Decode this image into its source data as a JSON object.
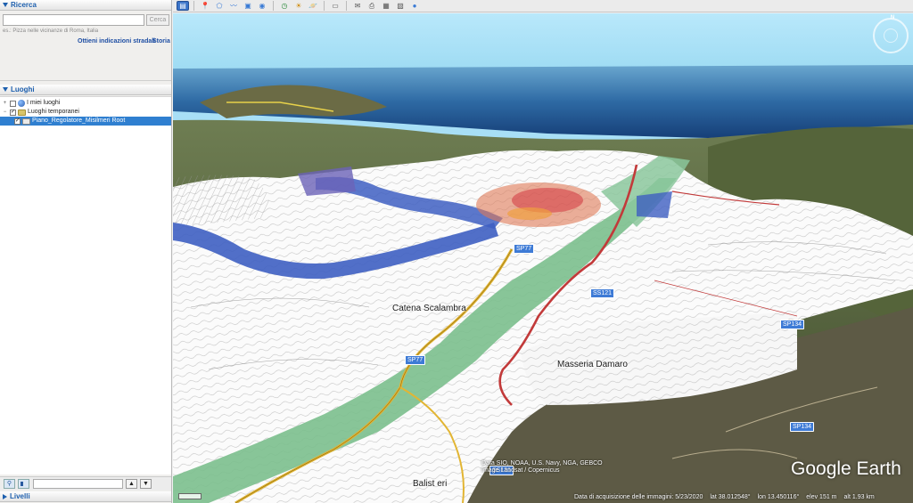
{
  "sidebar": {
    "search": {
      "title": "Ricerca",
      "placeholder": "",
      "button": "Cerca",
      "hint": "es.: Pizza nelle vicinanze di Roma, Italia",
      "directions_link": "Ottieni indicazioni stradali",
      "history_link": "Storia"
    },
    "places": {
      "title": "Luoghi",
      "items": [
        {
          "label": "I miei luoghi",
          "expander": "+",
          "checked": false
        },
        {
          "label": "Luoghi temporanei",
          "expander": "−",
          "checked": true
        },
        {
          "label": "Piano_Regolatore_Misilmeri Root",
          "checked": true,
          "selected": true
        }
      ]
    },
    "layers": {
      "title": "Livelli"
    }
  },
  "map": {
    "road_labels": [
      "SP77",
      "SS121",
      "SP134",
      "SP134",
      "SS121",
      "SP77"
    ],
    "place_labels": [
      "Catena Scalambra",
      "Masseria Damaro",
      "Balist eri"
    ],
    "attribution": [
      "Data SIO, NOAA, U.S. Navy, NGA, GEBCO",
      "Image Landsat / Copernicus"
    ],
    "logo": "Google Earth",
    "status": {
      "imagery_date": "Data di acquisizione delle immagini: 5/23/2020",
      "lat": "lat 38.012548°",
      "lon": "lon 13.450116°",
      "elev": "elev 151 m",
      "eye_alt": "alt 1.93 km"
    },
    "compass_n": "N"
  },
  "colors": {
    "sea": "#1f5a98",
    "sky": "#a8dff6",
    "plan_white": "#ffffff",
    "zone_green": "#7bbf8d",
    "zone_blue": "#3e5fc2",
    "road_red": "#c23a3a",
    "road_yellow": "#e2b533",
    "terrain": "#4f6a3a"
  }
}
